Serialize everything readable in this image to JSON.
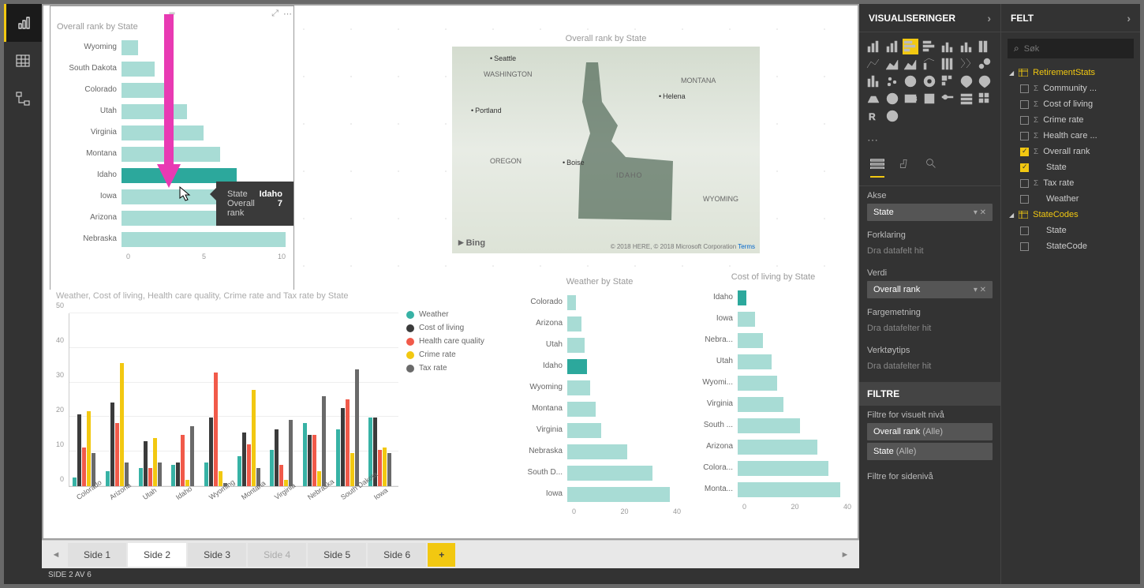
{
  "panels": {
    "visualizations": "VISUALISERINGER",
    "fields": "FELT",
    "filters": "FILTRE"
  },
  "search_placeholder": "Søk",
  "wells": {
    "axis": {
      "label": "Akse",
      "value": "State"
    },
    "legend": {
      "label": "Forklaring",
      "placeholder": "Dra datafelt hit"
    },
    "value": {
      "label": "Verdi",
      "value": "Overall rank"
    },
    "saturation": {
      "label": "Fargemetning",
      "placeholder": "Dra datafelter hit"
    },
    "tooltips": {
      "label": "Verktøytips",
      "placeholder": "Dra datafelter hit"
    }
  },
  "filters": {
    "visual_level": "Filtre for visuelt nivå",
    "page_level": "Filtre for sidenivå",
    "items": [
      {
        "field": "Overall rank",
        "cond": "(Alle)"
      },
      {
        "field": "State",
        "cond": "(Alle)"
      }
    ]
  },
  "field_tables": [
    {
      "name": "RetirementStats",
      "fields": [
        {
          "name": "Community ...",
          "checked": false,
          "agg": true
        },
        {
          "name": "Cost of living",
          "checked": false,
          "agg": true
        },
        {
          "name": "Crime rate",
          "checked": false,
          "agg": true
        },
        {
          "name": "Health care ...",
          "checked": false,
          "agg": true
        },
        {
          "name": "Overall rank",
          "checked": true,
          "agg": true
        },
        {
          "name": "State",
          "checked": true,
          "agg": false
        },
        {
          "name": "Tax rate",
          "checked": false,
          "agg": true
        },
        {
          "name": "Weather",
          "checked": false,
          "agg": false
        }
      ]
    },
    {
      "name": "StateCodes",
      "fields": [
        {
          "name": "State",
          "checked": false,
          "agg": false
        },
        {
          "name": "StateCode",
          "checked": false,
          "agg": false
        }
      ]
    }
  ],
  "tooltip": {
    "state_label": "State",
    "state_value": "Idaho",
    "rank_label": "Overall rank",
    "rank_value": "7"
  },
  "pages": {
    "labels": [
      "Side 1",
      "Side 2",
      "Side 3",
      "Side 4",
      "Side 5",
      "Side 6"
    ],
    "active_index": 1,
    "disabled_index": 3
  },
  "status": "SIDE 2 AV 6",
  "map": {
    "title": "Overall rank by State",
    "bing": "Bing",
    "attribution": "© 2018 HERE, © 2018 Microsoft Corporation",
    "terms": "Terms",
    "labels": {
      "washington": "WASHINGTON",
      "montana": "MONTANA",
      "oregon": "OREGON",
      "idaho": "IDAHO",
      "wyoming": "WYOMING"
    },
    "cities": {
      "seattle": "Seattle",
      "portland": "Portland",
      "boise": "Boise",
      "helena": "Helena"
    }
  },
  "chart_data": [
    {
      "id": "overall_rank",
      "type": "bar",
      "title": "Overall rank by State",
      "orientation": "horizontal",
      "xlim": [
        0,
        10
      ],
      "x_ticks": [
        0,
        5,
        10
      ],
      "categories": [
        "Wyoming",
        "South Dakota",
        "Colorado",
        "Utah",
        "Virginia",
        "Montana",
        "Idaho",
        "Iowa",
        "Arizona",
        "Nebraska"
      ],
      "values": [
        1,
        2,
        3,
        4,
        5,
        6,
        7,
        8,
        9,
        10
      ],
      "highlighted_index": 6
    },
    {
      "id": "clustered",
      "type": "bar",
      "title": "Weather, Cost of living, Health care quality, Crime rate and Tax rate by State",
      "ylim": [
        0,
        50
      ],
      "y_ticks": [
        0,
        10,
        20,
        30,
        40,
        50
      ],
      "categories": [
        "Colorado",
        "Arizona",
        "Utah",
        "Idaho",
        "Wyoming",
        "Montana",
        "Virginia",
        "Nebraska",
        "South Dakota",
        "Iowa"
      ],
      "series": [
        {
          "name": "Weather",
          "color": "#37b2a5",
          "values": [
            3,
            5,
            6,
            7,
            8,
            10,
            12,
            21,
            19,
            23
          ]
        },
        {
          "name": "Cost of living",
          "color": "#3b3b3b",
          "values": [
            24,
            28,
            15,
            8,
            23,
            18,
            19,
            17,
            26,
            23
          ]
        },
        {
          "name": "Health care quality",
          "color": "#f15a4a",
          "values": [
            13,
            21,
            6,
            17,
            38,
            14,
            7,
            17,
            29,
            12
          ]
        },
        {
          "name": "Crime rate",
          "color": "#f2c811",
          "values": [
            25,
            41,
            16,
            2,
            5,
            32,
            2,
            5,
            11,
            13
          ]
        },
        {
          "name": "Tax rate",
          "color": "#6a6a6a",
          "values": [
            11,
            8,
            8,
            20,
            1,
            6,
            22,
            30,
            39,
            11
          ]
        }
      ]
    },
    {
      "id": "weather",
      "type": "bar",
      "title": "Weather by State",
      "orientation": "horizontal",
      "xlim": [
        0,
        40
      ],
      "x_ticks": [
        0,
        20,
        40
      ],
      "categories": [
        "Colorado",
        "Arizona",
        "Utah",
        "Idaho",
        "Wyoming",
        "Montana",
        "Virginia",
        "Nebraska",
        "South D...",
        "Iowa"
      ],
      "values": [
        3,
        5,
        6,
        7,
        8,
        10,
        12,
        21,
        30,
        36
      ],
      "highlighted_index": 3
    },
    {
      "id": "cost_of_living",
      "type": "bar",
      "title": "Cost of living by State",
      "orientation": "horizontal",
      "xlim": [
        0,
        40
      ],
      "x_ticks": [
        0,
        20,
        40
      ],
      "categories": [
        "Idaho",
        "Iowa",
        "Nebra...",
        "Utah",
        "Wyomi...",
        "Virginia",
        "South ...",
        "Arizona",
        "Colora...",
        "Monta..."
      ],
      "values": [
        3,
        6,
        9,
        12,
        14,
        16,
        22,
        28,
        32,
        36
      ],
      "highlighted_index": 0
    }
  ]
}
